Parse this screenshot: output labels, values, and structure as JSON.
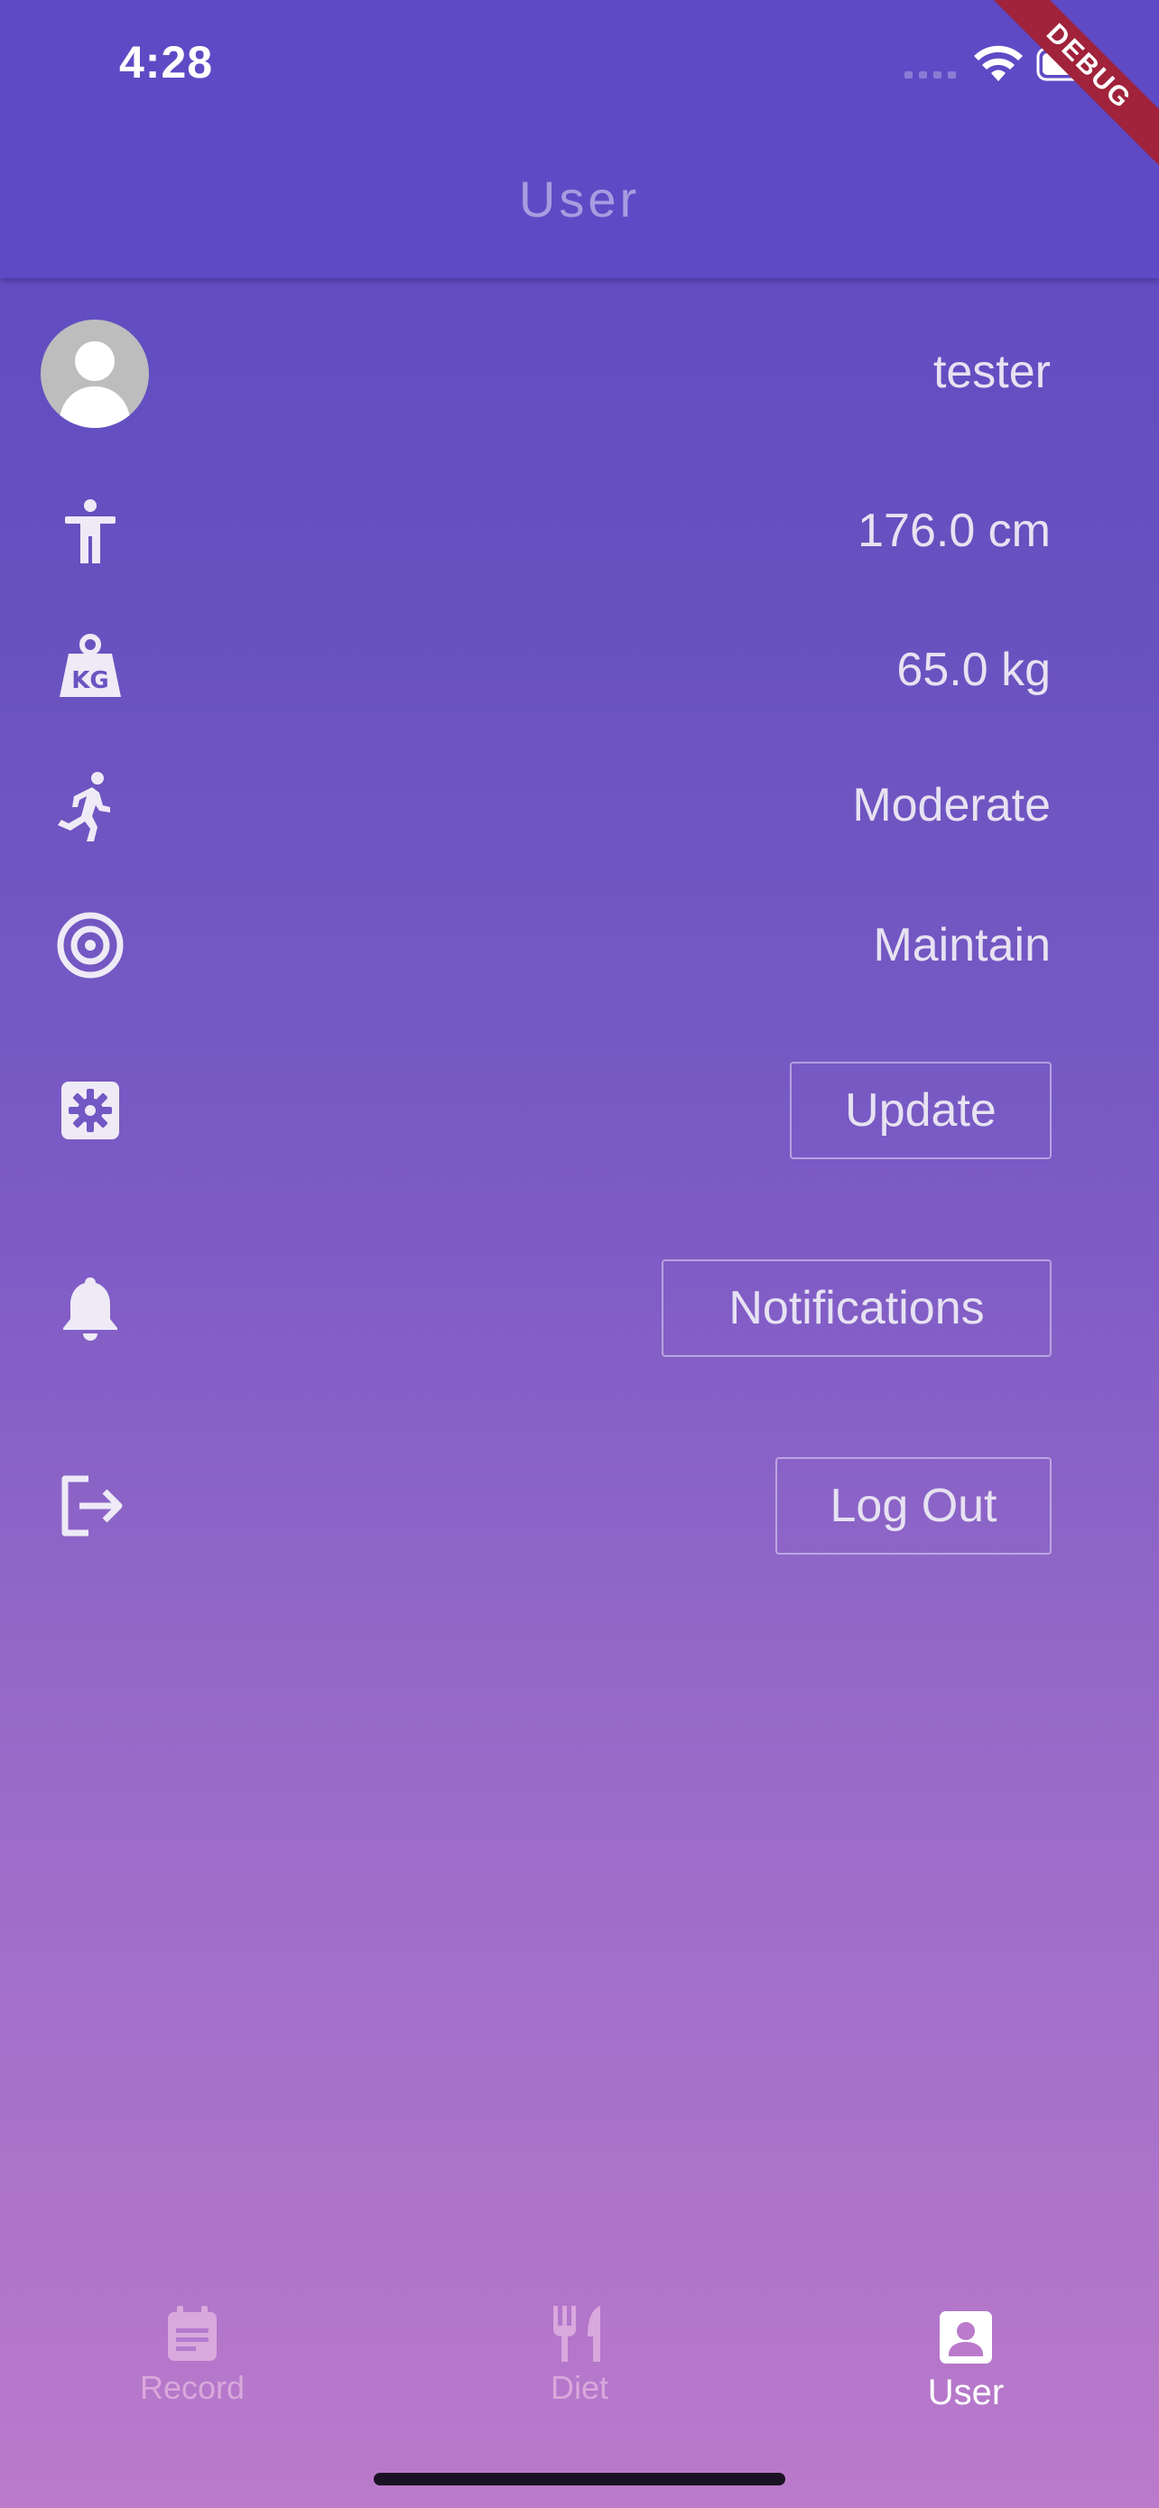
{
  "status_bar": {
    "time": "4:28",
    "debug_label": "DEBUG"
  },
  "app_bar": {
    "title": "User"
  },
  "profile": {
    "username": "tester",
    "height": "176.0 cm",
    "weight": "65.0 kg",
    "activity_level": "Moderate",
    "goal": "Maintain"
  },
  "actions": {
    "update_label": "Update",
    "notifications_label": "Notifications",
    "logout_label": "Log Out"
  },
  "bottom_nav": {
    "items": [
      {
        "label": "Record",
        "icon": "calendar-note-icon",
        "active": false
      },
      {
        "label": "Diet",
        "icon": "fork-knife-icon",
        "active": false
      },
      {
        "label": "User",
        "icon": "user-card-icon",
        "active": true
      }
    ]
  },
  "colors": {
    "app_bar": "#5f4ac5",
    "gradient_top": "#5f4ac5",
    "gradient_bottom": "#bb7acb",
    "text": "#e7e2f2",
    "title": "#a79ce0",
    "debug_ribbon": "#a0223b",
    "nav_inactive": "#d9a8dc",
    "nav_active": "#ffffff"
  }
}
